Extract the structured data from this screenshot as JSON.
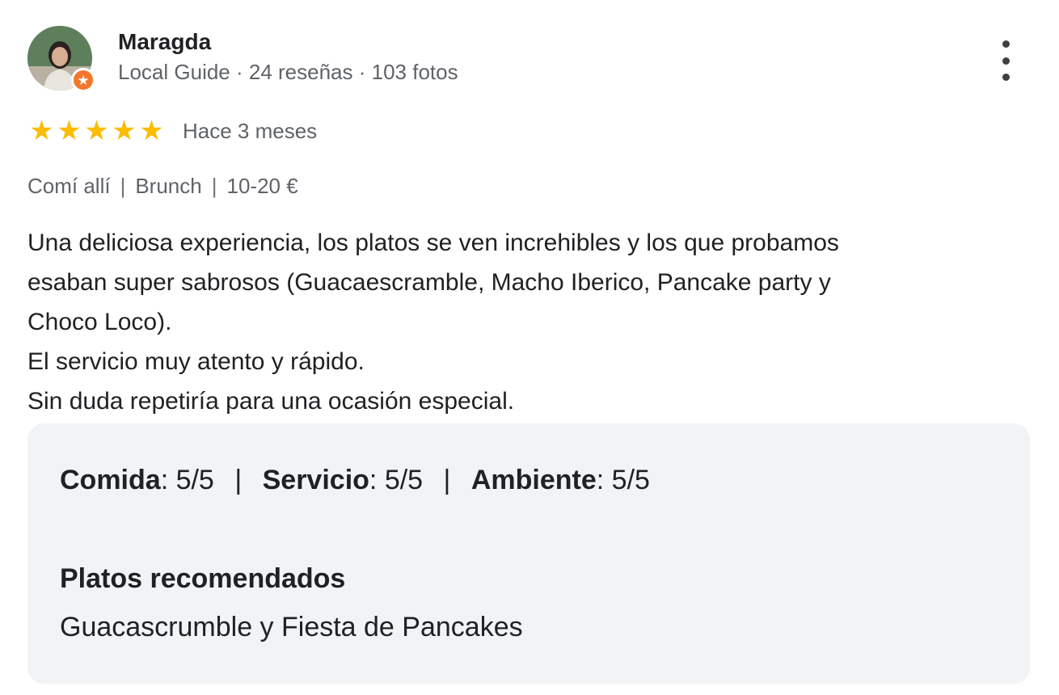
{
  "reviewer": {
    "name": "Maragda",
    "meta": "Local Guide · 24 reseñas · 103 fotos",
    "badge_icon": "local-guide-star-icon",
    "badge_color": "#f4762b"
  },
  "menu_icon": "more-vert-icon",
  "rating": {
    "stars": 5,
    "max_stars": 5,
    "star_color": "#fbbc04",
    "star_glyph": "★",
    "date": "Hace 3 meses"
  },
  "visit": {
    "service": "Comí allí",
    "meal": "Brunch",
    "price": "10-20 €",
    "separator": "|"
  },
  "review": {
    "lines": [
      "Una deliciosa experiencia, los platos se ven increhibles y los que probamos",
      "esaban super sabrosos (Guacaescramble, Macho Iberico, Pancake party y",
      "Choco Loco).",
      "El servicio muy atento y rápido.",
      "Sin duda repetiría para una ocasión especial."
    ]
  },
  "details": {
    "scores": [
      {
        "label": "Comida",
        "value": ": 5/5"
      },
      {
        "label": "Servicio",
        "value": ": 5/5"
      },
      {
        "label": "Ambiente",
        "value": ": 5/5"
      }
    ],
    "score_separator": "|",
    "dishes_title": "Platos recomendados",
    "dishes_value": "Guacascrumble y Fiesta de Pancakes"
  }
}
